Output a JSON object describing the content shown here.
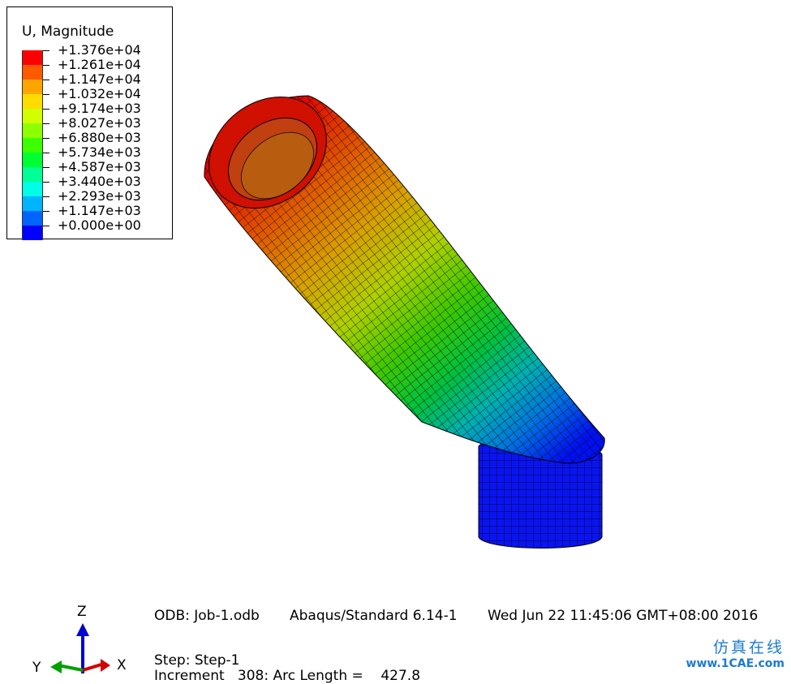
{
  "legend": {
    "title": "U, Magnitude",
    "entries": [
      {
        "label": "+1.376e+04",
        "color": "#ff0000"
      },
      {
        "label": "+1.261e+04",
        "color": "#ff5a00"
      },
      {
        "label": "+1.147e+04",
        "color": "#ffa500"
      },
      {
        "label": "+1.032e+04",
        "color": "#ffdc00"
      },
      {
        "label": "+9.174e+03",
        "color": "#d2ff00"
      },
      {
        "label": "+8.027e+03",
        "color": "#8cff00"
      },
      {
        "label": "+6.880e+03",
        "color": "#3cff00"
      },
      {
        "label": "+5.734e+03",
        "color": "#00ff32"
      },
      {
        "label": "+4.587e+03",
        "color": "#00ff96"
      },
      {
        "label": "+3.440e+03",
        "color": "#00ffe6"
      },
      {
        "label": "+2.293e+03",
        "color": "#00b4ff"
      },
      {
        "label": "+1.147e+03",
        "color": "#0064ff"
      },
      {
        "label": "+0.000e+00",
        "color": "#0000ff"
      }
    ]
  },
  "info": {
    "odb": "ODB: Job-1.odb",
    "solver": "Abaqus/Standard 6.14-1",
    "date": "Wed Jun 22 11:45:06 GMT+08:00 2016",
    "step": "Step: Step-1",
    "increment": "Increment   308: Arc Length =    427.8"
  },
  "triad": {
    "x": "X",
    "y": "Y",
    "z": "Z",
    "x_color": "#d00000",
    "y_color": "#00a000",
    "z_color": "#0000d0"
  },
  "watermark": {
    "cn": "仿真在线",
    "url": "www.1CAE.com"
  }
}
